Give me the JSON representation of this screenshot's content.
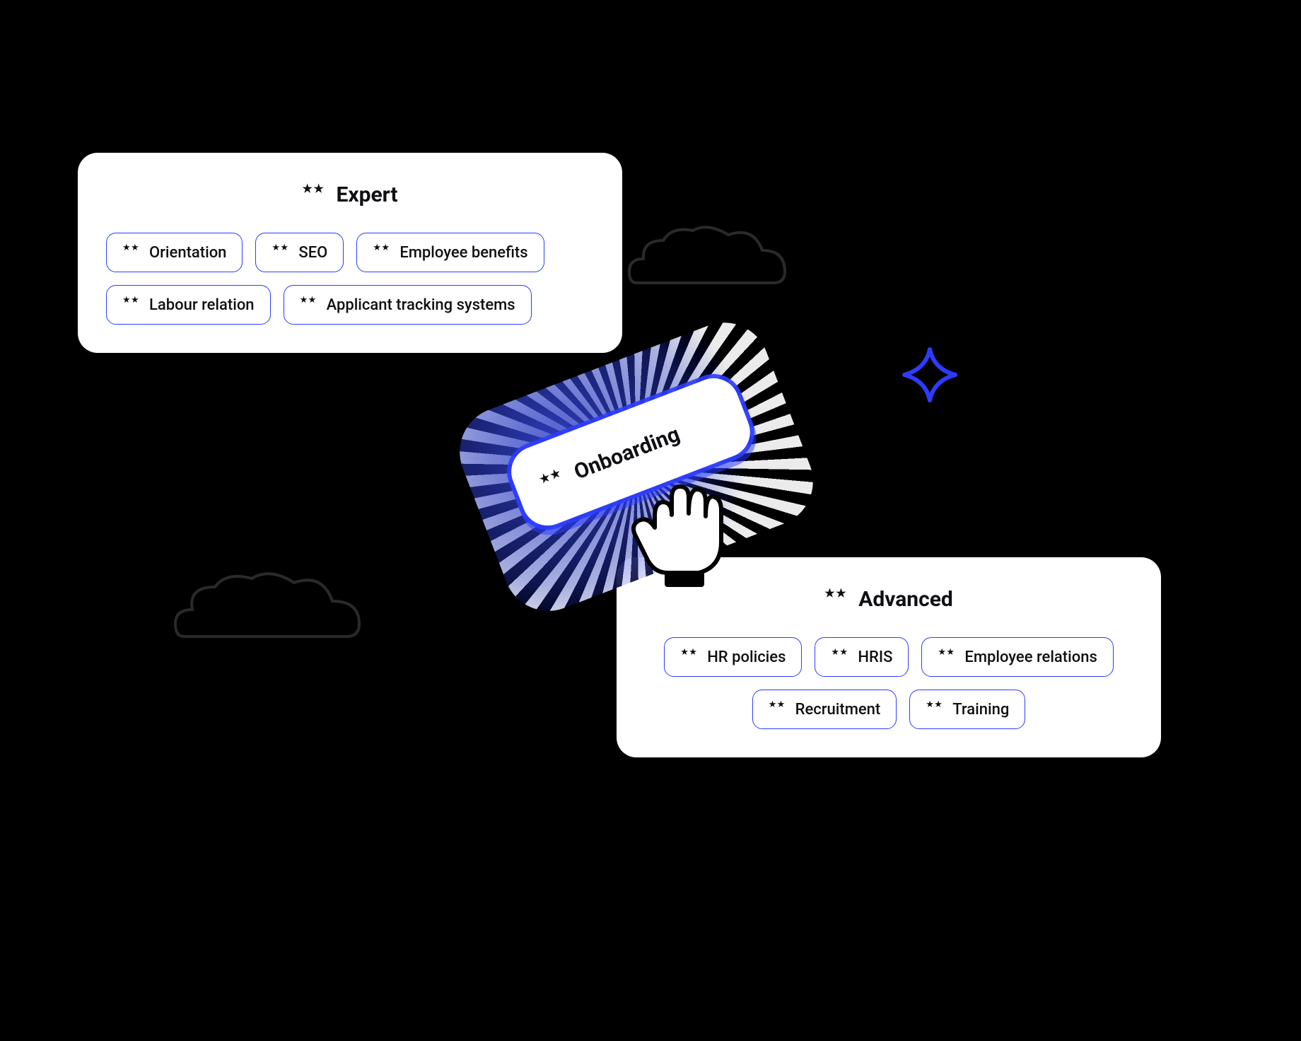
{
  "expert": {
    "title": "Expert",
    "chips": [
      "Orientation",
      "SEO",
      "Employee benefits",
      "Labour relation",
      "Applicant tracking systems"
    ]
  },
  "advanced": {
    "title": "Advanced",
    "chips": [
      "HR policies",
      "HRIS",
      "Employee relations",
      "Recruitment",
      "Training"
    ]
  },
  "floating": {
    "label": "Onboarding"
  },
  "colors": {
    "accent": "#2c3cff"
  }
}
